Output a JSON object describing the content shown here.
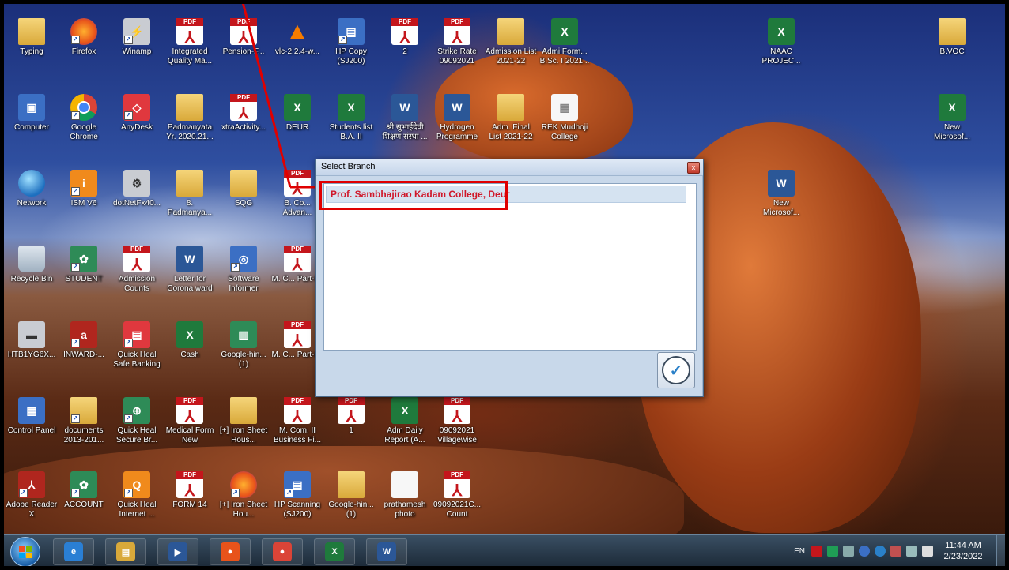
{
  "desktop": {
    "icons": [
      {
        "label": "Typing",
        "kind": "folder",
        "glyph": "",
        "shortcut": false
      },
      {
        "label": "Firefox",
        "kind": "fox",
        "glyph": "",
        "shortcut": true
      },
      {
        "label": "Winamp",
        "kind": "gray",
        "glyph": "⚡",
        "shortcut": true
      },
      {
        "label": "Integrated Quality Ma...",
        "kind": "pdf",
        "glyph": "",
        "shortcut": false
      },
      {
        "label": "Pension-F...",
        "kind": "pdf",
        "glyph": "",
        "shortcut": false
      },
      {
        "label": "vlc-2.2.4-w...",
        "kind": "vlc",
        "glyph": "▲",
        "shortcut": false
      },
      {
        "label": "HP Copy (SJ200)",
        "kind": "blue",
        "glyph": "▤",
        "shortcut": true
      },
      {
        "label": "2",
        "kind": "pdf",
        "glyph": "",
        "shortcut": false
      },
      {
        "label": "Strike Rate 09092021",
        "kind": "pdf",
        "glyph": "",
        "shortcut": false
      },
      {
        "label": "Admission List 2021-22",
        "kind": "folder",
        "glyph": "",
        "shortcut": false
      },
      {
        "label": "Admi.Form... B.Sc. I 2021...",
        "kind": "excel",
        "glyph": "X",
        "shortcut": false
      },
      {
        "label": "NAAC PROJEC...",
        "kind": "excel",
        "glyph": "X",
        "shortcut": false
      },
      {
        "label": "B.VOC",
        "kind": "folder",
        "glyph": "",
        "shortcut": false
      },
      {
        "label": "Computer",
        "kind": "blue",
        "glyph": "▣",
        "shortcut": false
      },
      {
        "label": "Google Chrome",
        "kind": "chrome",
        "glyph": "",
        "shortcut": true
      },
      {
        "label": "AnyDesk",
        "kind": "red",
        "glyph": "◇",
        "shortcut": true
      },
      {
        "label": "Padmanyata Yr. 2020.21...",
        "kind": "folder",
        "glyph": "",
        "shortcut": false
      },
      {
        "label": "xtraActivity...",
        "kind": "pdf",
        "glyph": "",
        "shortcut": false
      },
      {
        "label": "DEUR",
        "kind": "excel",
        "glyph": "X",
        "shortcut": false
      },
      {
        "label": "Students list B.A. II",
        "kind": "excel",
        "glyph": "X",
        "shortcut": false
      },
      {
        "label": "श्री सुभाईदेवी शिक्षण संस्था ...",
        "kind": "word",
        "glyph": "W",
        "shortcut": false
      },
      {
        "label": "Hydrogen Programme",
        "kind": "word",
        "glyph": "W",
        "shortcut": false
      },
      {
        "label": "Adm. Final List 2021-22",
        "kind": "folder",
        "glyph": "",
        "shortcut": false
      },
      {
        "label": "REK Mudhoji College",
        "kind": "white",
        "glyph": "▦",
        "shortcut": false
      },
      {
        "label": "New Microsof...",
        "kind": "excel",
        "glyph": "X",
        "shortcut": false
      },
      {
        "label": "Network",
        "kind": "globe",
        "glyph": "",
        "shortcut": false
      },
      {
        "label": "ISM V6",
        "kind": "orange",
        "glyph": "i",
        "shortcut": true
      },
      {
        "label": "dotNetFx40...",
        "kind": "gray",
        "glyph": "⚙",
        "shortcut": false
      },
      {
        "label": "8. Padmanya...",
        "kind": "folder",
        "glyph": "",
        "shortcut": false
      },
      {
        "label": "SQG",
        "kind": "folder",
        "glyph": "",
        "shortcut": false
      },
      {
        "label": "B. Co... Advan...",
        "kind": "pdf",
        "glyph": "",
        "shortcut": false
      },
      {
        "label": "New Microsof...",
        "kind": "word",
        "glyph": "W",
        "shortcut": false
      },
      {
        "label": "Recycle Bin",
        "kind": "recycle",
        "glyph": "",
        "shortcut": false
      },
      {
        "label": "STUDENT",
        "kind": "green",
        "glyph": "✿",
        "shortcut": true
      },
      {
        "label": "Admission Counts",
        "kind": "pdf",
        "glyph": "",
        "shortcut": false
      },
      {
        "label": "Letter for Corona ward",
        "kind": "word",
        "glyph": "W",
        "shortcut": false
      },
      {
        "label": "Software Informer",
        "kind": "blue",
        "glyph": "◎",
        "shortcut": true
      },
      {
        "label": "M. C... Part-I...",
        "kind": "pdf",
        "glyph": "",
        "shortcut": false
      },
      {
        "label": "HTB1YG6X...",
        "kind": "gray",
        "glyph": "▬",
        "shortcut": false
      },
      {
        "label": "INWARD-...",
        "kind": "darkred",
        "glyph": "a",
        "shortcut": true
      },
      {
        "label": "Quick Heal Safe Banking",
        "kind": "red",
        "glyph": "▤",
        "shortcut": true
      },
      {
        "label": "Cash",
        "kind": "excel",
        "glyph": "X",
        "shortcut": false
      },
      {
        "label": "Google-hin... (1)",
        "kind": "green",
        "glyph": "▥",
        "shortcut": false
      },
      {
        "label": "M. C... Part-I...",
        "kind": "pdf",
        "glyph": "",
        "shortcut": false
      },
      {
        "label": "Control Panel",
        "kind": "blue",
        "glyph": "▦",
        "shortcut": false
      },
      {
        "label": "documents 2013-201...",
        "kind": "folder",
        "glyph": "",
        "shortcut": true
      },
      {
        "label": "Quick Heal Secure Br...",
        "kind": "green",
        "glyph": "⊕",
        "shortcut": true
      },
      {
        "label": "Medical Form New",
        "kind": "pdf",
        "glyph": "",
        "shortcut": false
      },
      {
        "label": "[+] Iron Sheet Hous...",
        "kind": "folder",
        "glyph": "",
        "shortcut": false
      },
      {
        "label": "M. Com. II Business Fi...",
        "kind": "pdf",
        "glyph": "",
        "shortcut": false
      },
      {
        "label": "1",
        "kind": "pdf",
        "glyph": "",
        "shortcut": false
      },
      {
        "label": "Adm Daily Report (A...",
        "kind": "excel",
        "glyph": "X",
        "shortcut": false
      },
      {
        "label": "09092021 Villagewise",
        "kind": "pdf",
        "glyph": "",
        "shortcut": false
      },
      {
        "label": "Adobe Reader X",
        "kind": "darkred",
        "glyph": "⅄",
        "shortcut": true
      },
      {
        "label": "ACCOUNT",
        "kind": "green",
        "glyph": "✿",
        "shortcut": true
      },
      {
        "label": "Quick Heal Internet ...",
        "kind": "orange",
        "glyph": "Q",
        "shortcut": true
      },
      {
        "label": "FORM 14",
        "kind": "pdf",
        "glyph": "",
        "shortcut": false
      },
      {
        "label": "[+] Iron Sheet Hou...",
        "kind": "fox",
        "glyph": "",
        "shortcut": true
      },
      {
        "label": "HP Scanning (SJ200)",
        "kind": "blue",
        "glyph": "▤",
        "shortcut": true
      },
      {
        "label": "Google-hin... (1)",
        "kind": "folder",
        "glyph": "",
        "shortcut": false
      },
      {
        "label": "prathamesh photo",
        "kind": "white",
        "glyph": "",
        "shortcut": false
      },
      {
        "label": "09092021C... Count",
        "kind": "pdf",
        "glyph": "",
        "shortcut": false
      }
    ]
  },
  "dialog": {
    "title": "Select Branch",
    "close_glyph": "x",
    "items": [
      {
        "label": "Prof. Sambhajirao Kadam College, Deur",
        "selected": true
      }
    ],
    "ok_glyph": "✓"
  },
  "taskbar": {
    "apps": [
      {
        "name": "taskbar-internet-explorer",
        "glyph": "e",
        "color": "#2a7fd4"
      },
      {
        "name": "taskbar-file-explorer",
        "glyph": "▤",
        "color": "#d9a93a"
      },
      {
        "name": "taskbar-media-player",
        "glyph": "▶",
        "color": "#2b5797"
      },
      {
        "name": "taskbar-firefox",
        "glyph": "●",
        "color": "#e8531a"
      },
      {
        "name": "taskbar-chrome",
        "glyph": "●",
        "color": "#db4437"
      },
      {
        "name": "taskbar-excel",
        "glyph": "X",
        "color": "#1f7a3c"
      },
      {
        "name": "taskbar-word",
        "glyph": "W",
        "color": "#2b5797"
      }
    ],
    "language": "EN",
    "time": "11:44 AM",
    "date": "2/23/2022"
  }
}
